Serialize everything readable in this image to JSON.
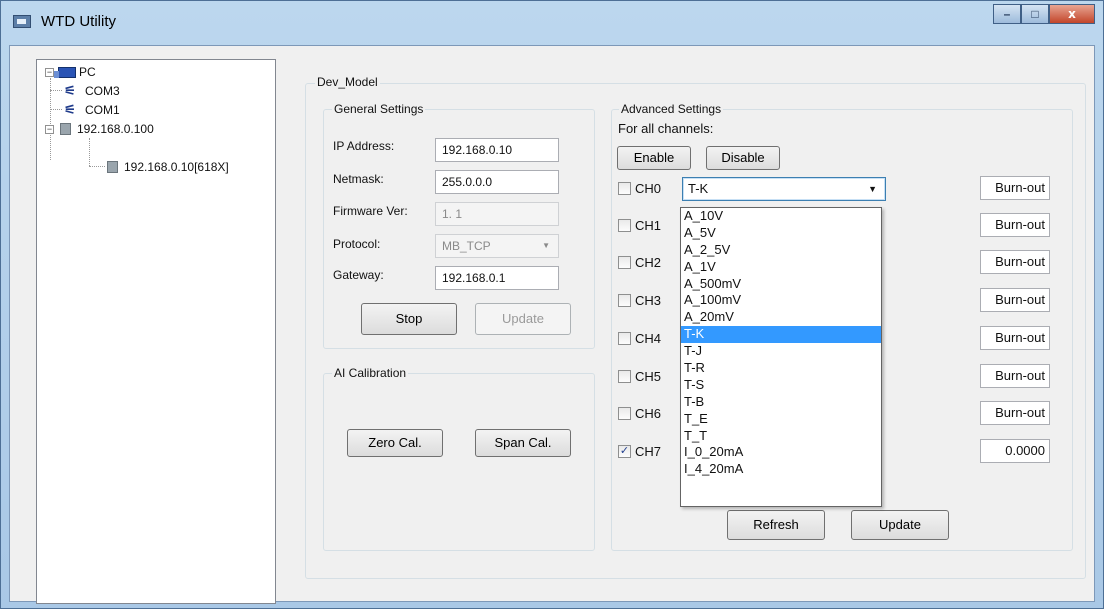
{
  "window": {
    "title": "WTD Utility",
    "controls": [
      "–",
      "□",
      "x"
    ]
  },
  "tree": {
    "root": "PC",
    "ports": [
      "COM3",
      "COM1"
    ],
    "network": "192.168.0.100",
    "device": "192.168.0.10[618X]"
  },
  "model": "Dev_Model",
  "general": {
    "title": "General Settings",
    "ip_label": "IP Address:",
    "ip_value": "192.168.0.10",
    "netmask_label": "Netmask:",
    "netmask_value": "255.0.0.0",
    "firmware_label": "Firmware Ver:",
    "firmware_value": "1. 1",
    "protocol_label": "Protocol:",
    "protocol_value": "MB_TCP",
    "gateway_label": "Gateway:",
    "gateway_value": "192.168.0.1",
    "stop_label": "Stop",
    "update_label": "Update"
  },
  "calibration": {
    "title": "AI Calibration",
    "zero_label": "Zero Cal.",
    "span_label": "Span Cal."
  },
  "advanced": {
    "title": "Advanced Settings",
    "all_channels": "For all channels:",
    "enable_label": "Enable",
    "disable_label": "Disable",
    "refresh_label": "Refresh",
    "update_label": "Update",
    "combo_value": "T-K",
    "channels": [
      {
        "label": "CH0",
        "checked": false,
        "value": "Burn-out"
      },
      {
        "label": "CH1",
        "checked": false,
        "value": "Burn-out"
      },
      {
        "label": "CH2",
        "checked": false,
        "value": "Burn-out"
      },
      {
        "label": "CH3",
        "checked": false,
        "value": "Burn-out"
      },
      {
        "label": "CH4",
        "checked": false,
        "value": "Burn-out"
      },
      {
        "label": "CH5",
        "checked": false,
        "value": "Burn-out"
      },
      {
        "label": "CH6",
        "checked": false,
        "value": "Burn-out"
      },
      {
        "label": "CH7",
        "checked": true,
        "value": "0.0000"
      }
    ],
    "options": [
      "A_10V",
      "A_5V",
      "A_2_5V",
      "A_1V",
      "A_500mV",
      "A_100mV",
      "A_20mV",
      "T-K",
      "T-J",
      "T-R",
      "T-S",
      "T-B",
      "T_E",
      "T_T",
      "I_0_20mA",
      "I_4_20mA"
    ],
    "selected_option": "T-K"
  }
}
